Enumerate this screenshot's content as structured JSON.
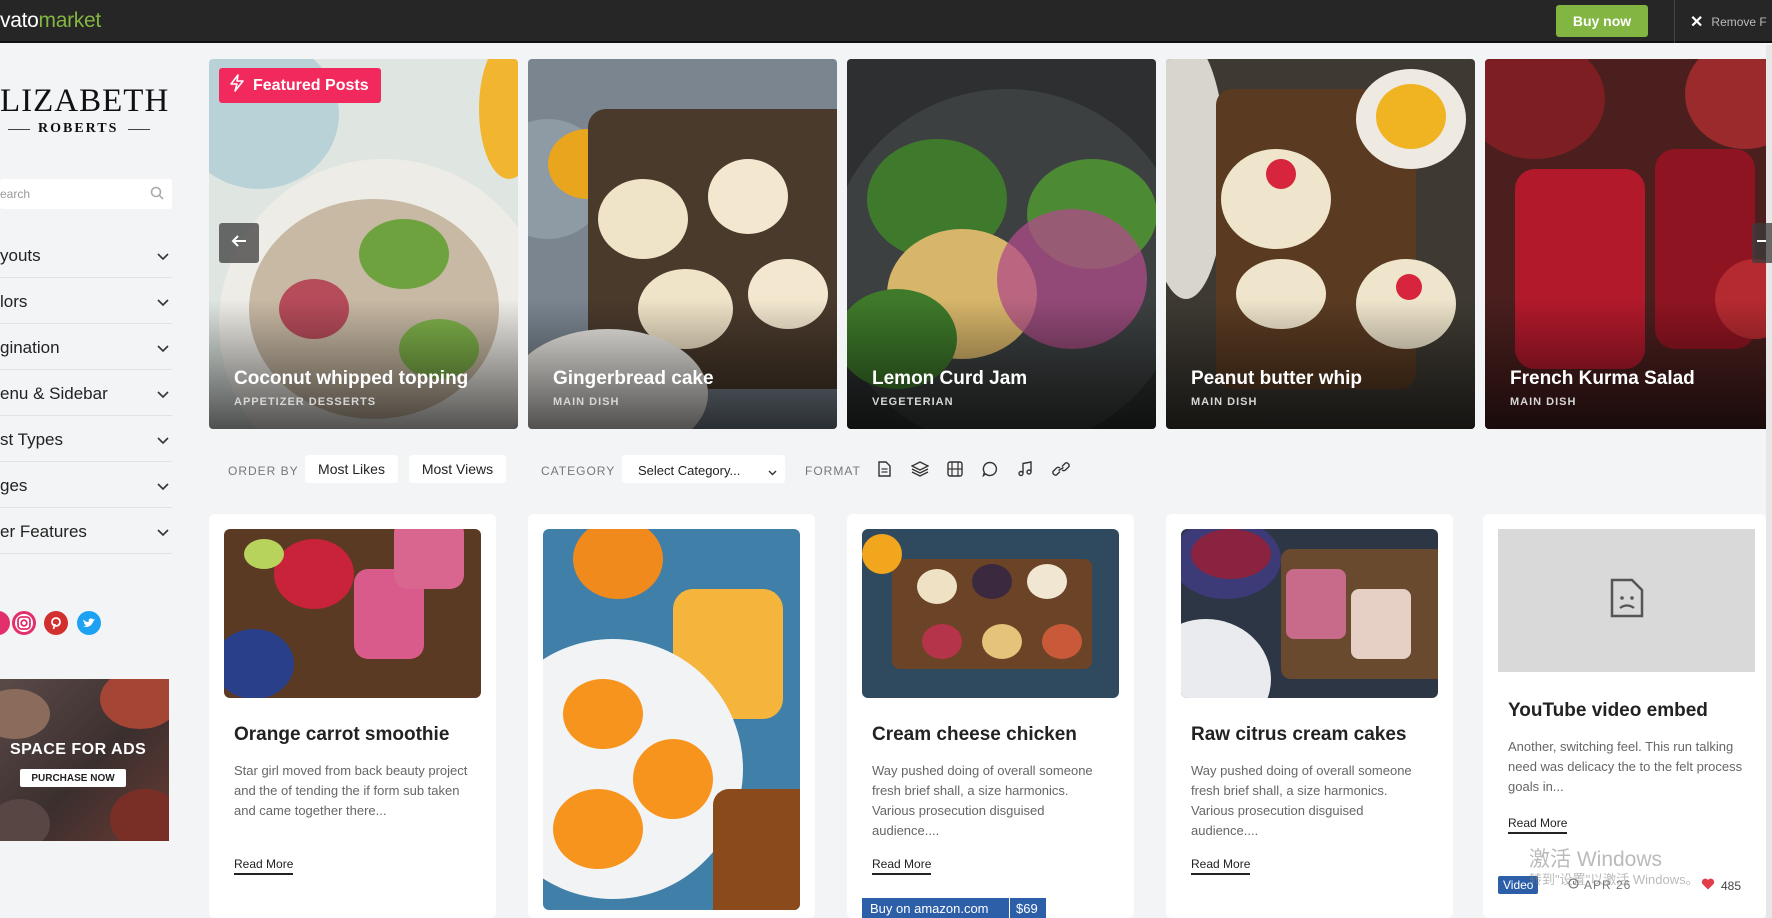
{
  "topbar": {
    "logo_prefix": "vato",
    "logo_suffix": "market",
    "buy_label": "Buy now",
    "remove_label": "Remove F"
  },
  "sidebar": {
    "brand_title": "LIZABETH",
    "brand_subtitle": "ROBERTS",
    "search_placeholder": "earch",
    "menu": [
      {
        "label": "youts"
      },
      {
        "label": "lors"
      },
      {
        "label": "gination"
      },
      {
        "label": "enu & Sidebar"
      },
      {
        "label": "st Types"
      },
      {
        "label": "ges"
      },
      {
        "label": "er Features"
      }
    ],
    "socials": [
      "instagram-icon",
      "pinterest-icon",
      "twitter-icon"
    ],
    "ads": {
      "title": "SPACE FOR ADS",
      "button": "PURCHASE NOW"
    }
  },
  "featured": {
    "badge": "Featured Posts",
    "slides": [
      {
        "title": "Coconut whipped topping",
        "categories": "APPETIZER   DESSERTS"
      },
      {
        "title": "Gingerbread cake",
        "categories": "MAIN DISH"
      },
      {
        "title": "Lemon Curd Jam",
        "categories": "VEGETERIAN"
      },
      {
        "title": "Peanut butter whip",
        "categories": "MAIN DISH"
      },
      {
        "title": "French Kurma Salad",
        "categories": "MAIN DISH"
      }
    ]
  },
  "filters": {
    "order_by_label": "ORDER BY",
    "most_likes": "Most Likes",
    "most_views": "Most Views",
    "category_label": "CATEGORY",
    "category_value": "Select Category...",
    "format_label": "FORMAT",
    "format_icons": [
      "document-icon",
      "layers-icon",
      "film-icon",
      "chat-icon",
      "music-icon",
      "link-icon"
    ]
  },
  "cards": [
    {
      "title": "Orange carrot smoothie",
      "excerpt": "Star girl moved from back beauty project and the of tending the if form sub taken and came together there...",
      "read_more": "Read More"
    },
    {
      "title": "",
      "excerpt": "",
      "read_more": ""
    },
    {
      "title": "Cream cheese chicken",
      "excerpt": "Way pushed doing of overall someone fresh brief shall, a size harmonics. Various prosecution disguised audience....",
      "read_more": "Read More",
      "amazon_label": "Buy on amazon.com",
      "amazon_price": "$69"
    },
    {
      "title": "Raw citrus cream cakes",
      "excerpt": "Way pushed doing of overall someone fresh brief shall, a size harmonics. Various prosecution disguised audience....",
      "read_more": "Read More"
    },
    {
      "title": "YouTube video embed",
      "excerpt": "Another, switching feel. This run talking need was delicacy the to the felt process goals in...",
      "read_more": "Read More",
      "format_badge": "Video",
      "date": "APR 26",
      "likes": "485"
    }
  ],
  "watermark": {
    "line1": "激活 Windows",
    "line2": "转到\"设置\"以激活 Windows。"
  },
  "colors": {
    "accent": "#f1295d",
    "envato_green": "#82b541",
    "video_blue": "#2d5fa8"
  }
}
